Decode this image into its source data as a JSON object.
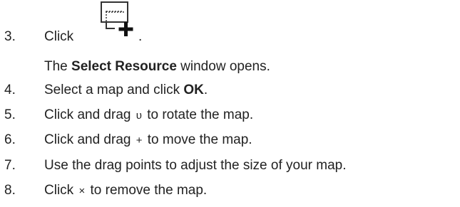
{
  "steps": [
    {
      "number": "3.",
      "text": "Click",
      "trailing": ".",
      "icon": "add-map-icon",
      "result_text": {
        "pre": "The ",
        "bold": "Select Resource",
        "post": " window opens."
      }
    },
    {
      "number": "4.",
      "pre": "Select a map and click ",
      "bold": "OK",
      "post": "."
    },
    {
      "number": "5.",
      "pre": "Click and drag ",
      "symbol": "υ",
      "symbol_icon": "rotate-icon",
      "post": " to rotate the map."
    },
    {
      "number": "6.",
      "pre": "Click and drag ",
      "symbol": "+",
      "symbol_icon": "move-icon",
      "post": " to move the map."
    },
    {
      "number": "7.",
      "text": "Use the drag points to adjust the size of your map."
    },
    {
      "number": "8.",
      "pre": "Click ",
      "symbol": "×",
      "symbol_icon": "remove-icon",
      "post": " to remove the map."
    }
  ]
}
